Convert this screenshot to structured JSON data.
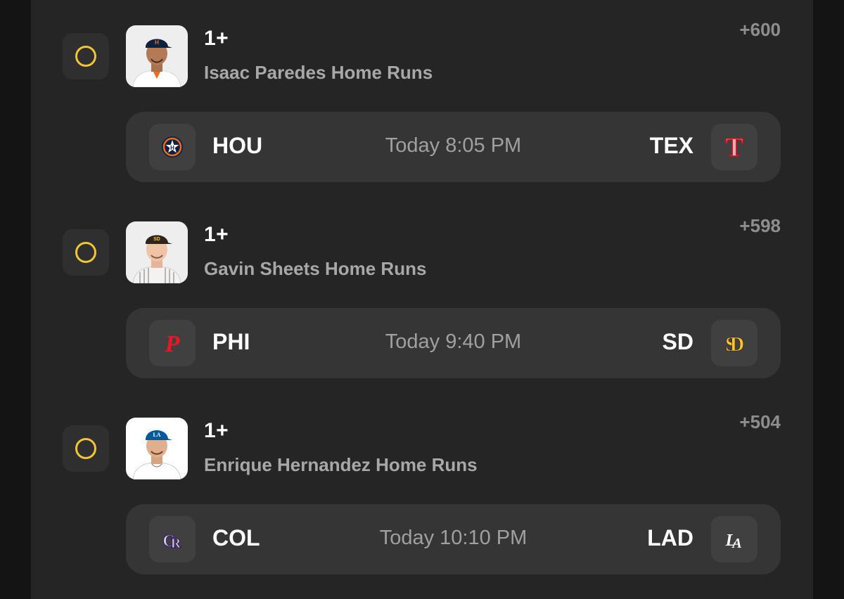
{
  "picks": [
    {
      "threshold": "1+",
      "market": "Isaac Paredes Home Runs",
      "odds": "+600",
      "headshot": "player-headshot-astros",
      "game": {
        "away_abbr": "HOU",
        "away_logo": "astros-logo-icon",
        "time": "Today 8:05 PM",
        "home_abbr": "TEX",
        "home_logo": "rangers-logo-icon"
      }
    },
    {
      "threshold": "1+",
      "market": "Gavin Sheets Home Runs",
      "odds": "+598",
      "headshot": "player-headshot-padres",
      "game": {
        "away_abbr": "PHI",
        "away_logo": "phillies-logo-icon",
        "time": "Today 9:40 PM",
        "home_abbr": "SD",
        "home_logo": "padres-logo-icon"
      }
    },
    {
      "threshold": "1+",
      "market": "Enrique Hernandez Home Runs",
      "odds": "+504",
      "headshot": "player-headshot-dodgers",
      "game": {
        "away_abbr": "COL",
        "away_logo": "rockies-logo-icon",
        "time": "Today 10:10 PM",
        "home_abbr": "LAD",
        "home_logo": "dodgers-logo-icon"
      }
    }
  ],
  "colors": {
    "accent": "#f1c533",
    "background": "#252525",
    "card": "#353535"
  }
}
